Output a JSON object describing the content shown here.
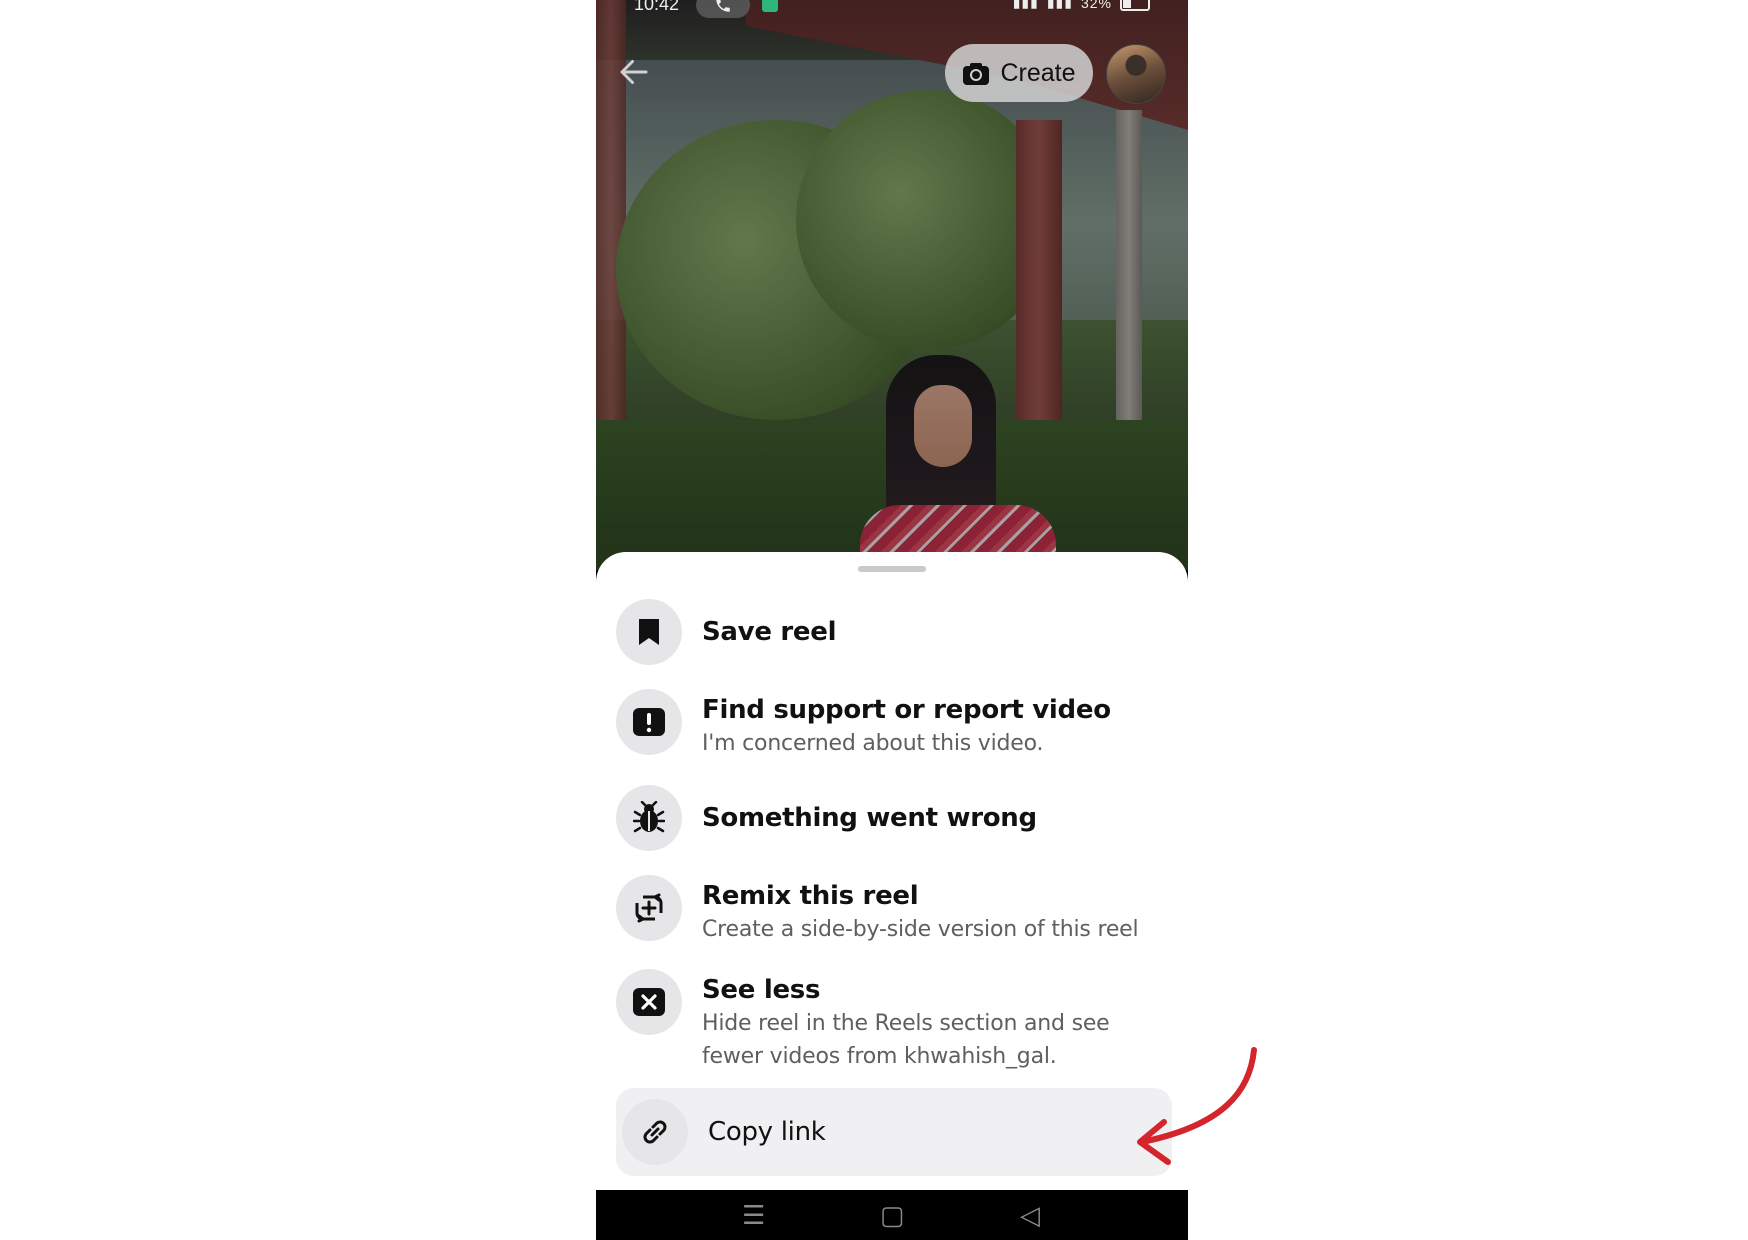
{
  "status_bar": {
    "time": "10:42",
    "battery": "32%"
  },
  "header": {
    "create_label": "Create"
  },
  "menu": {
    "items": [
      {
        "icon": "bookmark-icon",
        "title": "Save reel",
        "subtitle": ""
      },
      {
        "icon": "report-icon",
        "title": "Find support or report video",
        "subtitle": "I'm concerned about this video."
      },
      {
        "icon": "bug-icon",
        "title": "Something went wrong",
        "subtitle": ""
      },
      {
        "icon": "remix-icon",
        "title": "Remix this reel",
        "subtitle": "Create a side-by-side version of this reel"
      },
      {
        "icon": "close-box-icon",
        "title": "See less",
        "subtitle": "Hide reel in the Reels section and see fewer videos from khwahish_gal."
      },
      {
        "icon": "link-icon",
        "title": "Copy link",
        "subtitle": ""
      }
    ]
  },
  "colors": {
    "annotation_arrow": "#d3252b",
    "sheet_background": "#ffffff",
    "icon_circle": "#e6e6e9",
    "highlight_row": "#f0f0f2"
  }
}
